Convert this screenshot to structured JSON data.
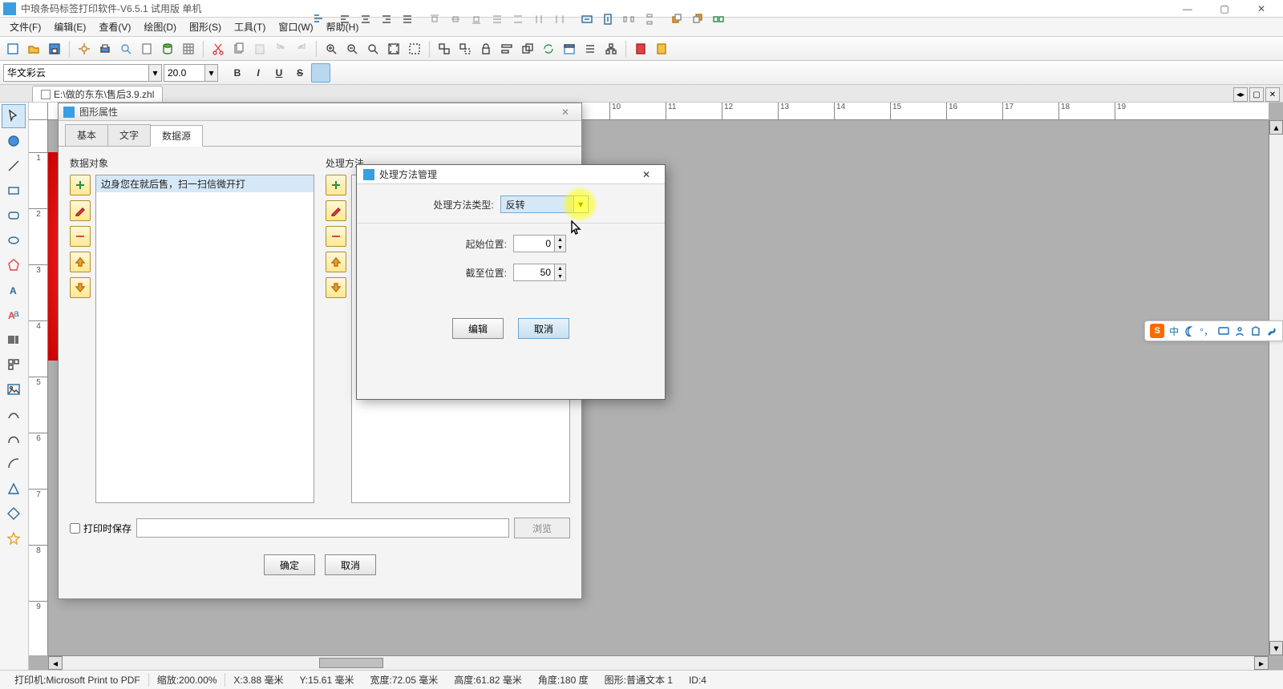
{
  "app": {
    "title": "中琅条码标签打印软件-V6.5.1 试用版 单机"
  },
  "menu": {
    "file": "文件(F)",
    "edit": "编辑(E)",
    "view": "查看(V)",
    "draw": "绘图(D)",
    "shape": "图形(S)",
    "tools": "工具(T)",
    "window": "窗口(W)",
    "help": "帮助(H)"
  },
  "format": {
    "font": "华文彩云",
    "size": "20.0"
  },
  "doc": {
    "path": "E:\\做的东东\\售后3.9.zhl"
  },
  "dialog1": {
    "title": "图形属性",
    "tabs": {
      "basic": "基本",
      "text": "文字",
      "datasource": "数据源"
    },
    "left_label": "数据对象",
    "right_label": "处理方法",
    "data_item": "边身您在就后售，扫一扫信微开打",
    "save_on_print": "打印时保存",
    "browse": "浏览",
    "ok": "确定",
    "cancel": "取消"
  },
  "dialog2": {
    "title": "处理方法管理",
    "type_label": "处理方法类型:",
    "type_value": "反转",
    "start_label": "起始位置:",
    "start_value": "0",
    "end_label": "截至位置:",
    "end_value": "50",
    "edit": "编辑",
    "cancel": "取消"
  },
  "status": {
    "printer": "打印机:Microsoft Print to PDF",
    "zoom": "缩放:200.00%",
    "x": "X:3.88 毫米",
    "y": "Y:15.61 毫米",
    "w": "宽度:72.05 毫米",
    "h": "高度:61.82 毫米",
    "angle": "角度:180 度",
    "obj": "图形:普通文本 1",
    "id": "ID:4"
  },
  "ime": {
    "lang": "中"
  }
}
